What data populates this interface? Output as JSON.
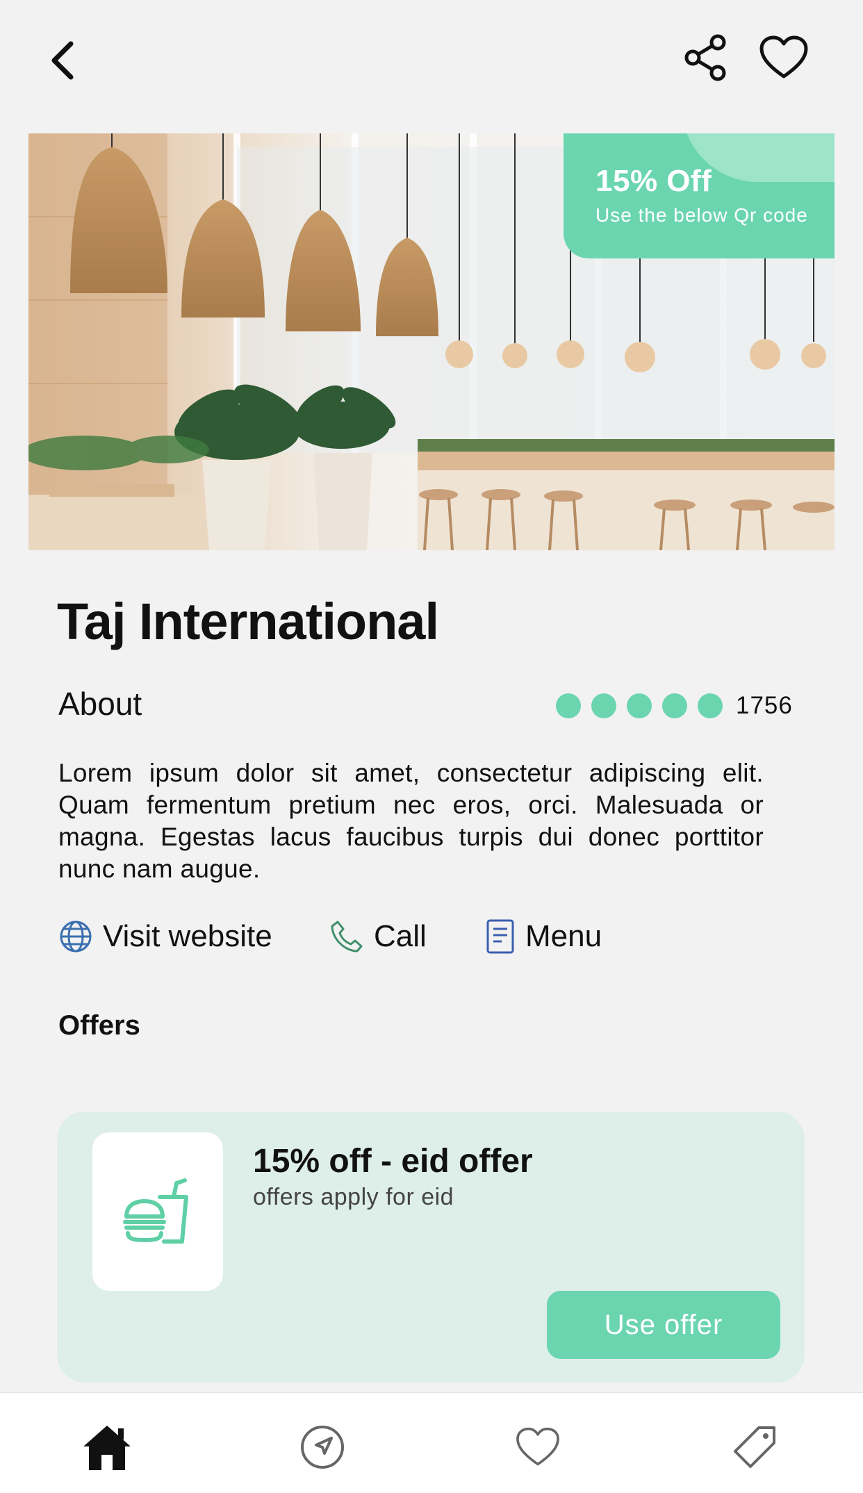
{
  "header": {
    "back_icon": "chevron-left-icon",
    "share_icon": "share-icon",
    "favorite_icon": "heart-outline-icon"
  },
  "hero": {
    "badge_title": "15% Off",
    "badge_subtitle": "Use the below Qr code"
  },
  "restaurant": {
    "name": "Taj International",
    "about_label": "About",
    "rating_dots": 5,
    "rating_count": "1756",
    "description": "Lorem ipsum dolor sit amet, consectetur adipiscing elit. Quam fermentum pretium nec eros, orci. Malesuada or magna. Egestas lacus faucibus turpis dui donec porttitor nunc nam augue."
  },
  "links": {
    "website": "Visit website",
    "call": "Call",
    "menu": "Menu"
  },
  "offers": {
    "heading": "Offers",
    "items": [
      {
        "title": "15% off - eid offer",
        "subtitle": "offers apply for eid",
        "button": "Use offer",
        "icon": "burger-drink-icon"
      }
    ]
  },
  "bottom_nav": {
    "items": [
      {
        "icon": "home-icon",
        "active": true
      },
      {
        "icon": "navigation-icon",
        "active": false
      },
      {
        "icon": "heart-icon",
        "active": false
      },
      {
        "icon": "tag-icon",
        "active": false
      }
    ]
  },
  "colors": {
    "accent": "#6bd5b0",
    "card_bg": "#deefe9",
    "background": "#f2f2f2"
  }
}
